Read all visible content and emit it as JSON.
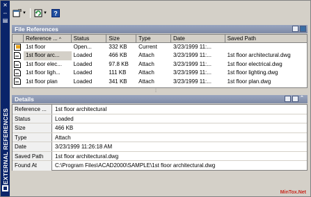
{
  "palette": {
    "vertical_title": "EXTERNAL REFERENCES"
  },
  "toolbar": {
    "attach_icon": "attach-dwg-icon",
    "refresh_icon": "refresh-icon",
    "help_icon": "help-icon"
  },
  "file_references": {
    "title": "File References",
    "columns": [
      "Reference ...",
      "Status",
      "Size",
      "Type",
      "Date",
      "Saved Path"
    ],
    "sort_indicator": "^",
    "rows": [
      {
        "name": "1st floor",
        "status": "Open...",
        "size": "332 KB",
        "type": "Current",
        "date": "3/23/1999 11:...",
        "path": "",
        "selected": false
      },
      {
        "name": "1st floor arc...",
        "status": "Loaded",
        "size": "466 KB",
        "type": "Attach",
        "date": "3/23/1999 11:...",
        "path": "1st floor architectural.dwg",
        "selected": true
      },
      {
        "name": "1st floor elec...",
        "status": "Loaded",
        "size": "97.8 KB",
        "type": "Attach",
        "date": "3/23/1999 11:...",
        "path": "1st floor electrical.dwg",
        "selected": false
      },
      {
        "name": "1st floor ligh...",
        "status": "Loaded",
        "size": "111 KB",
        "type": "Attach",
        "date": "3/23/1999 11:...",
        "path": "1st floor lighting.dwg",
        "selected": false
      },
      {
        "name": "1st floor plan",
        "status": "Loaded",
        "size": "341 KB",
        "type": "Attach",
        "date": "3/23/1999 11:...",
        "path": "1st floor plan.dwg",
        "selected": false
      }
    ]
  },
  "details": {
    "title": "Details",
    "rows": [
      {
        "key": "Reference ...",
        "value": "1st floor architectural"
      },
      {
        "key": "Status",
        "value": "Loaded"
      },
      {
        "key": "Size",
        "value": "466 KB"
      },
      {
        "key": "Type",
        "value": "Attach"
      },
      {
        "key": "Date",
        "value": "3/23/1999 11:26:18 AM"
      },
      {
        "key": "Saved Path",
        "value": "1st floor architectural.dwg"
      },
      {
        "key": "Found At",
        "value": "C:\\Program Files\\ACAD2000\\SAMPLE\\1st floor architectural.dwg"
      }
    ]
  },
  "watermark": "MinTox.Net",
  "colors": {
    "strip": "#0a246a",
    "header": "#8290ad",
    "panel": "#d4d0c8"
  }
}
